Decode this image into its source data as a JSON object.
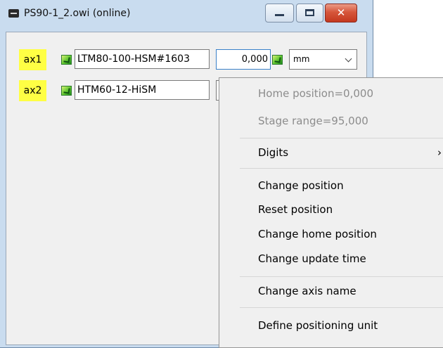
{
  "window": {
    "title": "PS90-1_2.owi (online)",
    "close_label": "✕"
  },
  "axes": [
    {
      "label": "ax1",
      "device": "LTM80-100-HSM#1603",
      "position": "0,000",
      "unit": "mm"
    },
    {
      "label": "ax2",
      "device": "HTM60-12-HiSM"
    }
  ],
  "context_menu": {
    "info": [
      "Home position=0,000",
      "Stage range=95,000"
    ],
    "digits": {
      "label": "Digits",
      "arrow": "›"
    },
    "actions": [
      "Change position",
      "Reset position",
      "Change home position",
      "Change update time"
    ],
    "rename": "Change axis name",
    "define_unit": "Define positioning unit"
  },
  "colors": {
    "axis_label_bg": "#ffff44",
    "frame": "#c9dcef",
    "close_button": "#d6563b"
  }
}
